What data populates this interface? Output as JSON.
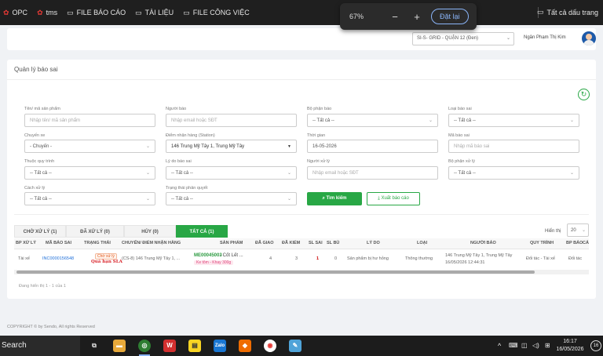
{
  "bookmarks": [
    {
      "icon": "tms-icon",
      "label": "OPC",
      "color": "#e53935"
    },
    {
      "icon": "tms-icon",
      "label": "tms",
      "color": "#e53935"
    },
    {
      "icon": "folder-icon",
      "label": "FILE BÁO CÁO"
    },
    {
      "icon": "folder-icon",
      "label": "TÀI LIỆU"
    },
    {
      "icon": "folder-icon",
      "label": "FILE CÔNG VIỆC"
    }
  ],
  "bookmarks_right": "Tất cả dấu trang",
  "zoom": {
    "level": "67%",
    "minus": "−",
    "plus": "+",
    "reset_label": "Đặt lại"
  },
  "header": {
    "branch": "SI-S- GRID - QUẬN 12 (Đen)",
    "user_name": "Ngân Phạm Thị Kim"
  },
  "page_title": "Quản lý báo sai",
  "filters": {
    "product": {
      "label": "Tên/ mã sản phẩm",
      "placeholder": "Nhập tên/ mã sản phẩm"
    },
    "reporter": {
      "label": "Người báo",
      "placeholder": "Nhập email hoặc SĐT"
    },
    "report_dept": {
      "label": "Bộ phận báo",
      "value": "-- Tất cả --"
    },
    "error_type": {
      "label": "Loại báo sai",
      "value": "-- Tất cả --"
    },
    "route": {
      "label": "Chuyến xe",
      "value": "- Chuyến -"
    },
    "station": {
      "label": "Điểm nhận hàng (Station)",
      "value": "146 Trung Mỹ Tây 1, Trung Mỹ Tây"
    },
    "time": {
      "label": "Thời gian",
      "value": "16-05-2026"
    },
    "error_code": {
      "label": "Mã báo sai",
      "placeholder": "Nhập mã báo sai"
    },
    "process": {
      "label": "Thuộc quy trình",
      "value": "-- Tất cả --"
    },
    "reason": {
      "label": "Lý do báo sai",
      "value": "-- Tất cả --"
    },
    "handler": {
      "label": "Người xử lý",
      "placeholder": "Nhập email hoặc SĐT"
    },
    "handle_dept": {
      "label": "Bộ phận xử lý",
      "value": "-- Tất cả --"
    },
    "method": {
      "label": "Cách xử lý",
      "value": "-- Tất cả --"
    },
    "approval": {
      "label": "Trạng thái phản quyết",
      "value": "-- Tất cả --"
    }
  },
  "actions": {
    "search": "Tìm kiếm",
    "export": "Xuất báo cáo"
  },
  "tabs": [
    {
      "label": "CHỜ XỬ LÝ (1)"
    },
    {
      "label": "ĐÃ XỬ LÝ (0)"
    },
    {
      "label": "HỦY (0)"
    },
    {
      "label": "TẤT CẢ (1)"
    }
  ],
  "page_size": {
    "label": "Hiển thị",
    "value": "20"
  },
  "table": {
    "columns": [
      "BP XỬ LÝ",
      "MÃ BÁO SAI",
      "TRẠNG THÁI",
      "CHUYẾN/ ĐIỂM NHẬN HÀNG",
      "SẢN PHẨM",
      "ĐÃ GIAO",
      "ĐÃ KIỂM",
      "SL SAI",
      "SL BÙ",
      "LÝ DO",
      "LOẠI",
      "NGƯỜI BÁO",
      "QUY TRÌNH",
      "BP BÁO",
      "CÁ"
    ],
    "row": {
      "handle_dept": "Tài xế",
      "code": "INC0000156548",
      "status": "Chờ xử lý",
      "sla": "Quá hạn SLA",
      "route": "(CS-8) 146 Trung Mỹ Tây 1, ...",
      "product_code": "ME00045003",
      "product_name": "- Cốt Lết ...",
      "product_tag": "Ke tôm - Khay 300g",
      "delivered": "4",
      "checked": "3",
      "wrong_qty": "1",
      "comp_qty": "0",
      "reason": "Sản phẩm bị hư hỏng",
      "type": "Thông thường",
      "reporter_line1": "146 Trung Mỹ Tây 1, Trung Mỹ Tây",
      "reporter_line2": "16/05/2026 12:44:31",
      "process": "Đối tác - Tài xế",
      "report_dept": "Đối tác"
    }
  },
  "table_info": "Đang hiển thị 1 - 1 của 1",
  "copyright": "COPYRIGHT © by Sendo, All rights Reserved",
  "taskbar": {
    "search": "Search",
    "time": "16:17",
    "date": "16/05/2026",
    "notifications": "16"
  }
}
